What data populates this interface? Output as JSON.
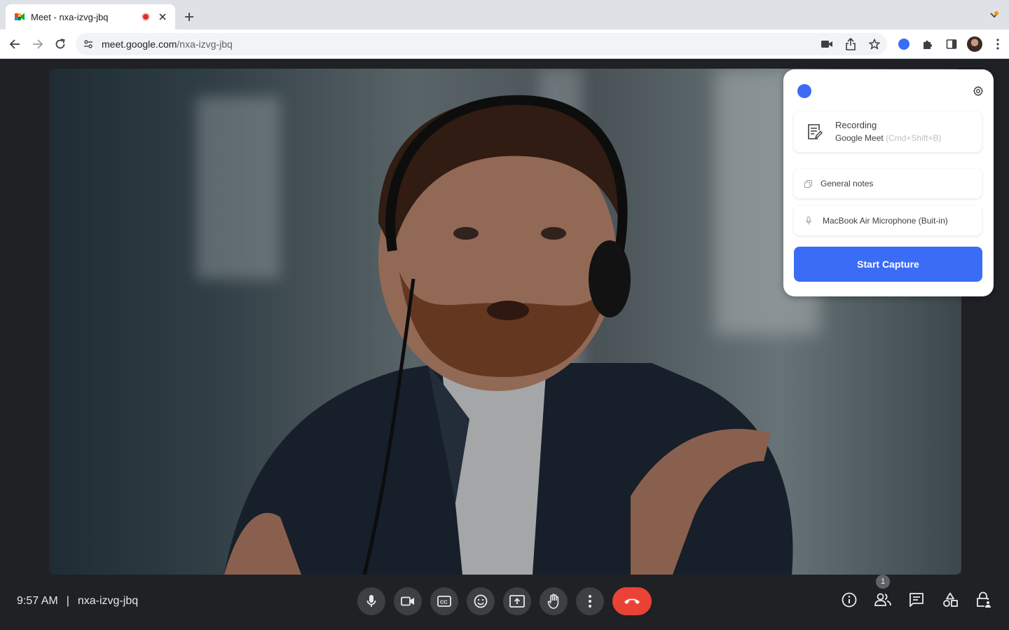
{
  "browser": {
    "tab_title": "Meet - nxa-izvg-jbq",
    "url_host": "meet.google.com",
    "url_path": "/nxa-izvg-jbq"
  },
  "meeting": {
    "time": "9:57 AM",
    "separator": "|",
    "code": "nxa-izvg-jbq",
    "participant_count": "1"
  },
  "popup": {
    "recording_title": "Recording",
    "recording_source": "Google Meet",
    "recording_shortcut": "(Cmd+Shift+B)",
    "notes_label": "General notes",
    "mic_label": "MacBook Air Microphone (Buit-in)",
    "capture_label": "Start Capture"
  },
  "colors": {
    "accent_blue": "#3b6cf6",
    "hangup_red": "#ea4335",
    "stage_bg": "#202124"
  }
}
